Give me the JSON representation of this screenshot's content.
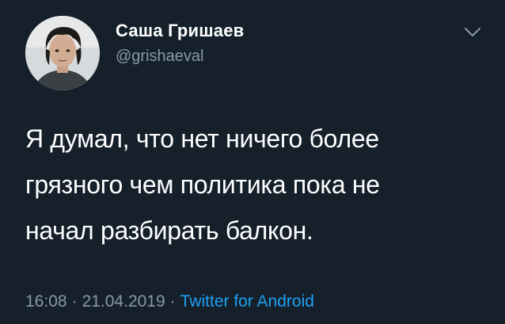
{
  "author": {
    "name": "Саша Гришаев",
    "handle": "@grishaeval"
  },
  "tweet": {
    "lines": [
      "Я думал, что нет ничего более",
      "грязного чем политика пока не",
      "начал разбирать балкон."
    ]
  },
  "meta": {
    "time": "16:08",
    "date": "21.04.2019",
    "separator": "·",
    "source": "Twitter for Android"
  },
  "colors": {
    "background": "#15202b",
    "text": "#ffffff",
    "secondary": "#8899a6",
    "link": "#1da1f2"
  },
  "icons": {
    "menu": "chevron-down-icon"
  }
}
